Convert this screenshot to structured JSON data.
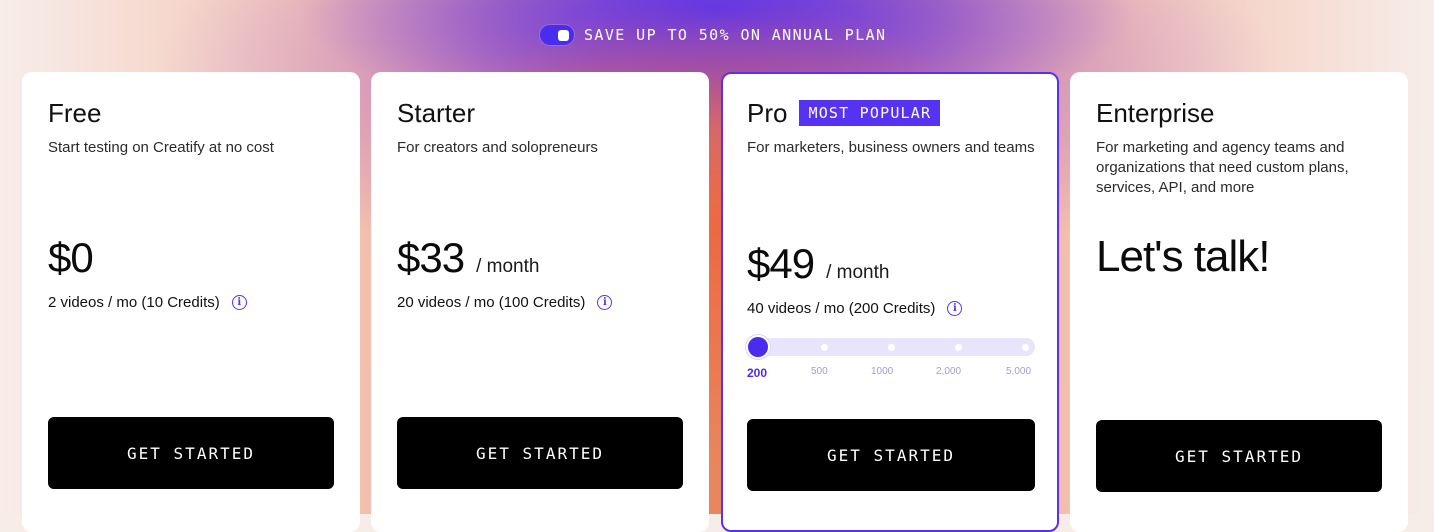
{
  "promo": {
    "text": "SAVE UP TO 50% ON ANNUAL PLAN",
    "toggle_on": true
  },
  "plans": [
    {
      "name": "Free",
      "description": "Start testing on Creatify at no cost",
      "price": "$0",
      "quota": "2 videos / mo (10 Credits)",
      "cta": "GET STARTED"
    },
    {
      "name": "Starter",
      "description": "For creators and solopreneurs",
      "price": "$33",
      "period": "/ month",
      "quota": "20 videos / mo (100 Credits)",
      "cta": "GET STARTED"
    },
    {
      "name": "Pro",
      "badge": "MOST POPULAR",
      "description": "For marketers, business owners and teams",
      "price": "$49",
      "period": "/ month",
      "quota": "40 videos / mo  (200 Credits)",
      "slider": {
        "options": [
          "200",
          "500",
          "1000",
          "2,000",
          "5,000"
        ],
        "selected": "200"
      },
      "cta": "GET STARTED"
    },
    {
      "name": "Enterprise",
      "description": "For marketing and agency teams and organizations that need custom plans, services, API, and more",
      "price": "Let's talk!",
      "cta": "GET STARTED"
    }
  ],
  "colors": {
    "accent": "#5633f2",
    "button": "#000000",
    "card": "#ffffff"
  },
  "icons": {
    "info": "info-circle-icon"
  }
}
